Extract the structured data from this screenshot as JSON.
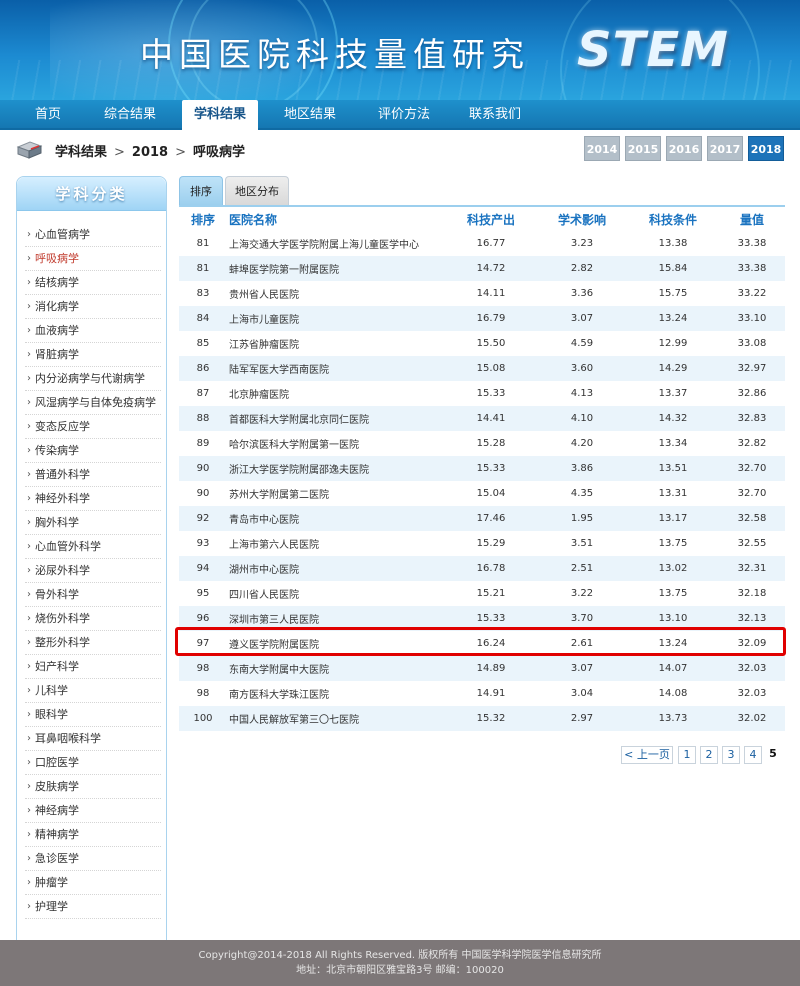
{
  "banner": {
    "title": "中国医院科技量值研究",
    "logo": "STEM"
  },
  "nav": {
    "items": [
      {
        "label": "首页"
      },
      {
        "label": "综合结果"
      },
      {
        "label": "学科结果",
        "active": true
      },
      {
        "label": "地区结果"
      },
      {
        "label": "评价方法"
      },
      {
        "label": "联系我们"
      }
    ]
  },
  "breadcrumb": {
    "parts": [
      "学科结果",
      "2018",
      "呼吸病学"
    ],
    "separator": ">"
  },
  "years": {
    "items": [
      "2014",
      "2015",
      "2016",
      "2017",
      "2018"
    ],
    "active": "2018"
  },
  "sidebar": {
    "title": "学科分类",
    "bullet": "›",
    "items": [
      "心血管病学",
      "呼吸病学",
      "结核病学",
      "消化病学",
      "血液病学",
      "肾脏病学",
      "内分泌病学与代谢病学",
      "风湿病学与自体免疫病学",
      "变态反应学",
      "传染病学",
      "普通外科学",
      "神经外科学",
      "胸外科学",
      "心血管外科学",
      "泌尿外科学",
      "骨外科学",
      "烧伤外科学",
      "整形外科学",
      "妇产科学",
      "儿科学",
      "眼科学",
      "耳鼻咽喉科学",
      "口腔医学",
      "皮肤病学",
      "神经病学",
      "精神病学",
      "急诊医学",
      "肿瘤学",
      "护理学"
    ],
    "active_index": 1
  },
  "tabs": [
    {
      "label": "排序",
      "active": true
    },
    {
      "label": "地区分布",
      "active": false
    }
  ],
  "table": {
    "headers": [
      "排序",
      "医院名称",
      "科技产出",
      "学术影响",
      "科技条件",
      "量值"
    ],
    "rows": [
      [
        "81",
        "上海交通大学医学院附属上海儿童医学中心",
        "16.77",
        "3.23",
        "13.38",
        "33.38"
      ],
      [
        "81",
        "蚌埠医学院第一附属医院",
        "14.72",
        "2.82",
        "15.84",
        "33.38"
      ],
      [
        "83",
        "贵州省人民医院",
        "14.11",
        "3.36",
        "15.75",
        "33.22"
      ],
      [
        "84",
        "上海市儿童医院",
        "16.79",
        "3.07",
        "13.24",
        "33.10"
      ],
      [
        "85",
        "江苏省肿瘤医院",
        "15.50",
        "4.59",
        "12.99",
        "33.08"
      ],
      [
        "86",
        "陆军军医大学西南医院",
        "15.08",
        "3.60",
        "14.29",
        "32.97"
      ],
      [
        "87",
        "北京肿瘤医院",
        "15.33",
        "4.13",
        "13.37",
        "32.86"
      ],
      [
        "88",
        "首都医科大学附属北京同仁医院",
        "14.41",
        "4.10",
        "14.32",
        "32.83"
      ],
      [
        "89",
        "哈尔滨医科大学附属第一医院",
        "15.28",
        "4.20",
        "13.34",
        "32.82"
      ],
      [
        "90",
        "浙江大学医学院附属邵逸夫医院",
        "15.33",
        "3.86",
        "13.51",
        "32.70"
      ],
      [
        "90",
        "苏州大学附属第二医院",
        "15.04",
        "4.35",
        "13.31",
        "32.70"
      ],
      [
        "92",
        "青岛市中心医院",
        "17.46",
        "1.95",
        "13.17",
        "32.58"
      ],
      [
        "93",
        "上海市第六人民医院",
        "15.29",
        "3.51",
        "13.75",
        "32.55"
      ],
      [
        "94",
        "湖州市中心医院",
        "16.78",
        "2.51",
        "13.02",
        "32.31"
      ],
      [
        "95",
        "四川省人民医院",
        "15.21",
        "3.22",
        "13.75",
        "32.18"
      ],
      [
        "96",
        "深圳市第三人民医院",
        "15.33",
        "3.70",
        "13.10",
        "32.13"
      ],
      [
        "97",
        "遵义医学院附属医院",
        "16.24",
        "2.61",
        "13.24",
        "32.09"
      ],
      [
        "98",
        "东南大学附属中大医院",
        "14.89",
        "3.07",
        "14.07",
        "32.03"
      ],
      [
        "98",
        "南方医科大学珠江医院",
        "14.91",
        "3.04",
        "14.08",
        "32.03"
      ],
      [
        "100",
        "中国人民解放军第三〇七医院",
        "15.32",
        "2.97",
        "13.73",
        "32.02"
      ]
    ],
    "highlighted_row": 16
  },
  "pagination": {
    "prev_label": "< 上一页",
    "pages": [
      "1",
      "2",
      "3",
      "4",
      "5"
    ],
    "current": "5"
  },
  "footer": {
    "line1": "Copyright@2014-2018 All Rights Reserved. 版权所有 中国医学科学院医学信息研究所",
    "line2": "地址：北京市朝阳区雅宝路3号 邮编：100020"
  },
  "colors": {
    "accent": "#1a73c0",
    "highlight": "#e00000",
    "active_side": "#c0392b"
  }
}
